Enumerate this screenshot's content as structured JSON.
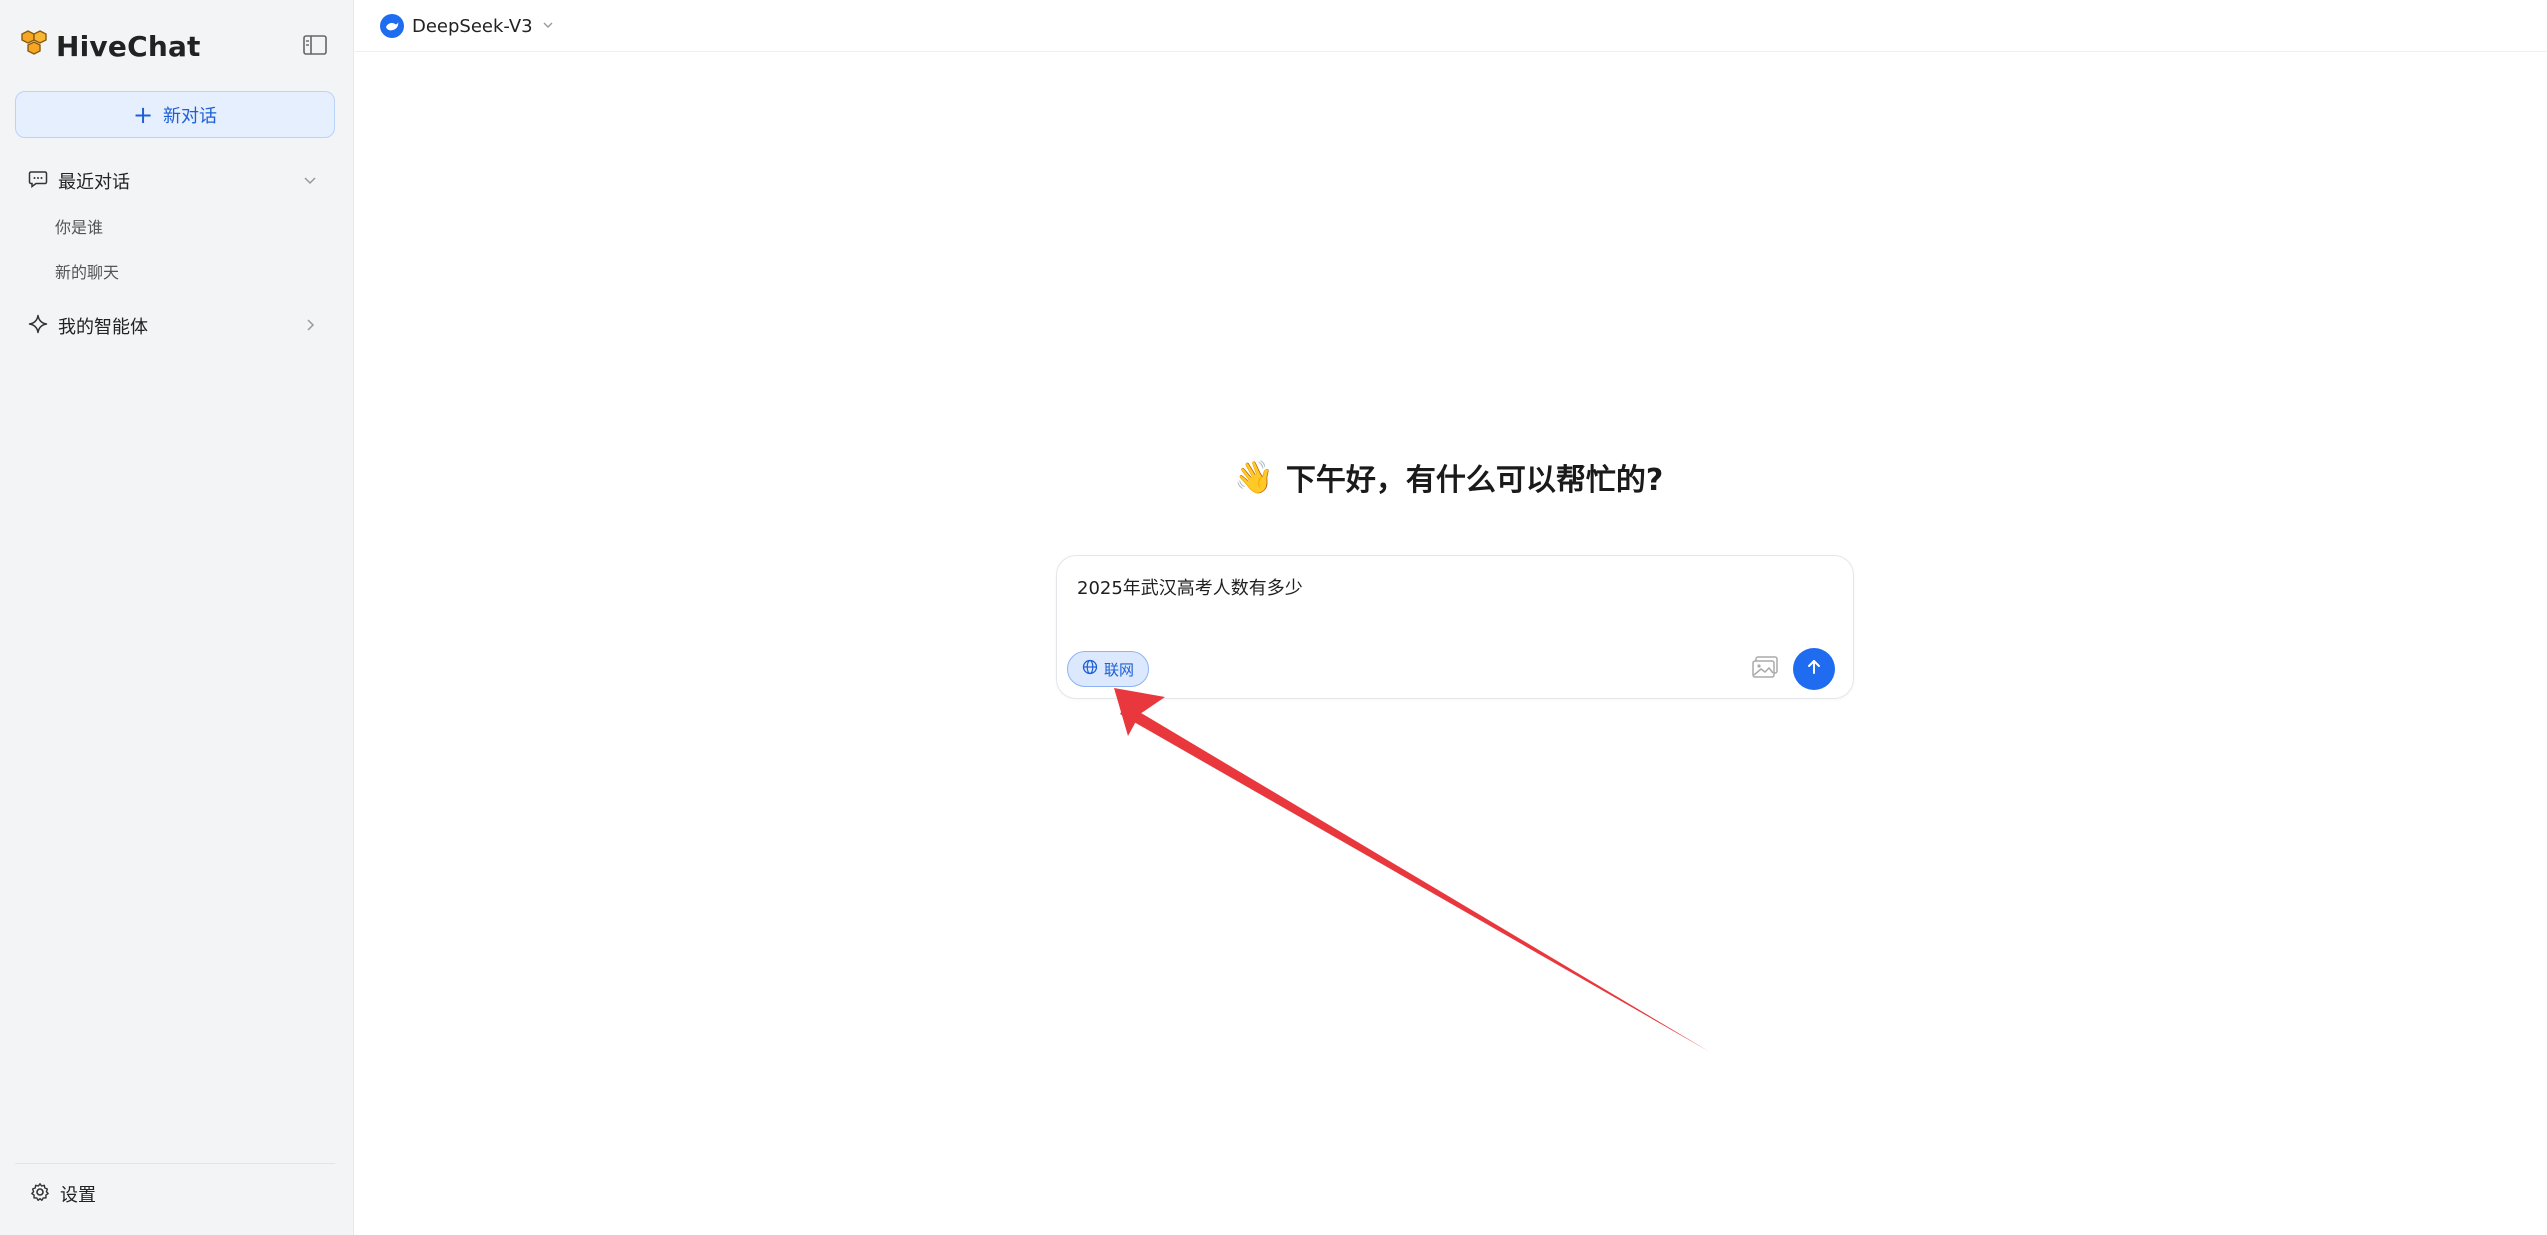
{
  "app": {
    "name": "HiveChat"
  },
  "sidebar": {
    "new_chat_label": "新对话",
    "recent_label": "最近对话",
    "conversations": [
      {
        "title": "你是谁"
      },
      {
        "title": "新的聊天"
      }
    ],
    "agents_label": "我的智能体",
    "settings_label": "设置"
  },
  "topbar": {
    "model_name": "DeepSeek-V3"
  },
  "main": {
    "greeting_emoji": "👋",
    "greeting": "下午好，有什么可以帮忙的?",
    "input_value": "2025年武汉高考人数有多少",
    "web_search_label": "联网",
    "web_search_enabled": true
  },
  "colors": {
    "accent": "#1f6cf0",
    "annotation_arrow": "#e8383d"
  },
  "icons": {
    "logo": "honeycomb-icon",
    "sidebar_toggle": "panel-left-icon",
    "new_chat": "plus-icon",
    "recent": "chat-bubble-icon",
    "agents": "sparkle-icon",
    "settings": "gear-icon",
    "web": "globe-icon",
    "image": "image-icon",
    "send": "arrow-up-icon"
  }
}
